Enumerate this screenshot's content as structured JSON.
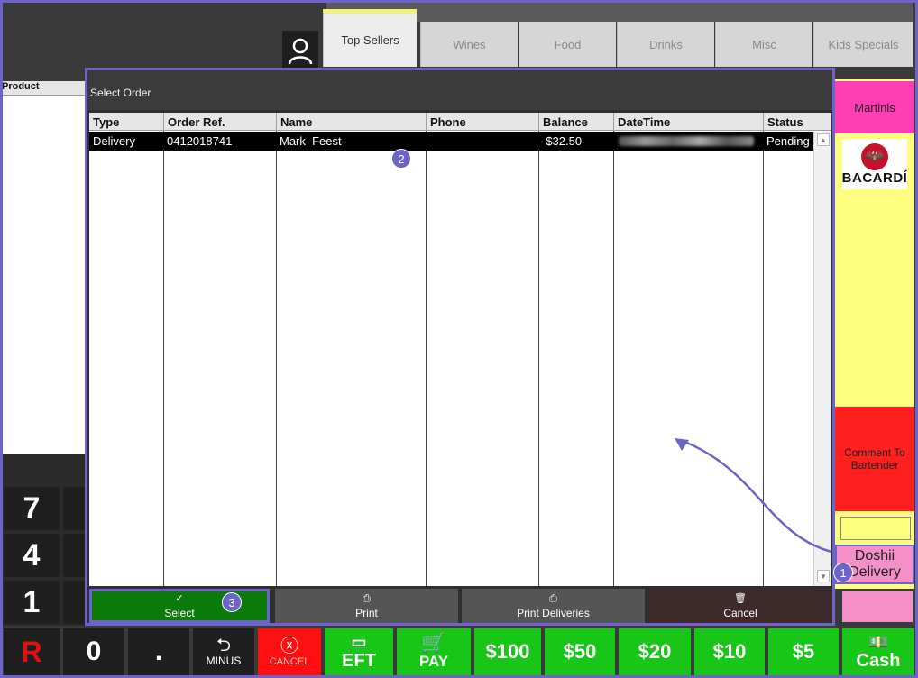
{
  "tabs": [
    {
      "label": "Top Sellers",
      "active": true
    },
    {
      "label": "Wines"
    },
    {
      "label": "Food"
    },
    {
      "label": "Drinks"
    },
    {
      "label": "Misc"
    },
    {
      "label": "Kids Specials"
    }
  ],
  "left_panel": {
    "header": "Product"
  },
  "right_buttons": {
    "martinis": "Martinis",
    "bacardi": "BACARDÍ",
    "comment": "Comment To Bartender",
    "doshii": "Doshii Delivery"
  },
  "keypad": {
    "seven": "7",
    "four": "4",
    "one": "1",
    "r": "R",
    "zero": "0",
    "dot": "."
  },
  "bottom": {
    "minus": "MINUS",
    "cancel": "CANCEL",
    "eft": "EFT",
    "pay": "PAY",
    "m100": "$100",
    "m50": "$50",
    "m20": "$20",
    "m10": "$10",
    "m5": "$5",
    "cash": "Cash"
  },
  "dialog": {
    "title": "Select Order",
    "columns": [
      "Type",
      "Order Ref.",
      "Name",
      "Phone",
      "Balance",
      "DateTime",
      "Status"
    ],
    "rows": [
      {
        "type": "Delivery",
        "order_ref": "0412018741",
        "name": "Mark  Feest",
        "phone": "",
        "balance": "-$32.50",
        "status": "Pending"
      }
    ],
    "actions": {
      "select": "Select",
      "print": "Print",
      "print_deliveries": "Print Deliveries",
      "cancel": "Cancel"
    }
  },
  "badges": {
    "one": "1",
    "two": "2",
    "three": "3"
  },
  "colors": {
    "accent": "#6d64c8",
    "green": "#17c617",
    "pink": "#ff3db5",
    "red": "#ff2020",
    "yellow": "#fdfd80"
  }
}
